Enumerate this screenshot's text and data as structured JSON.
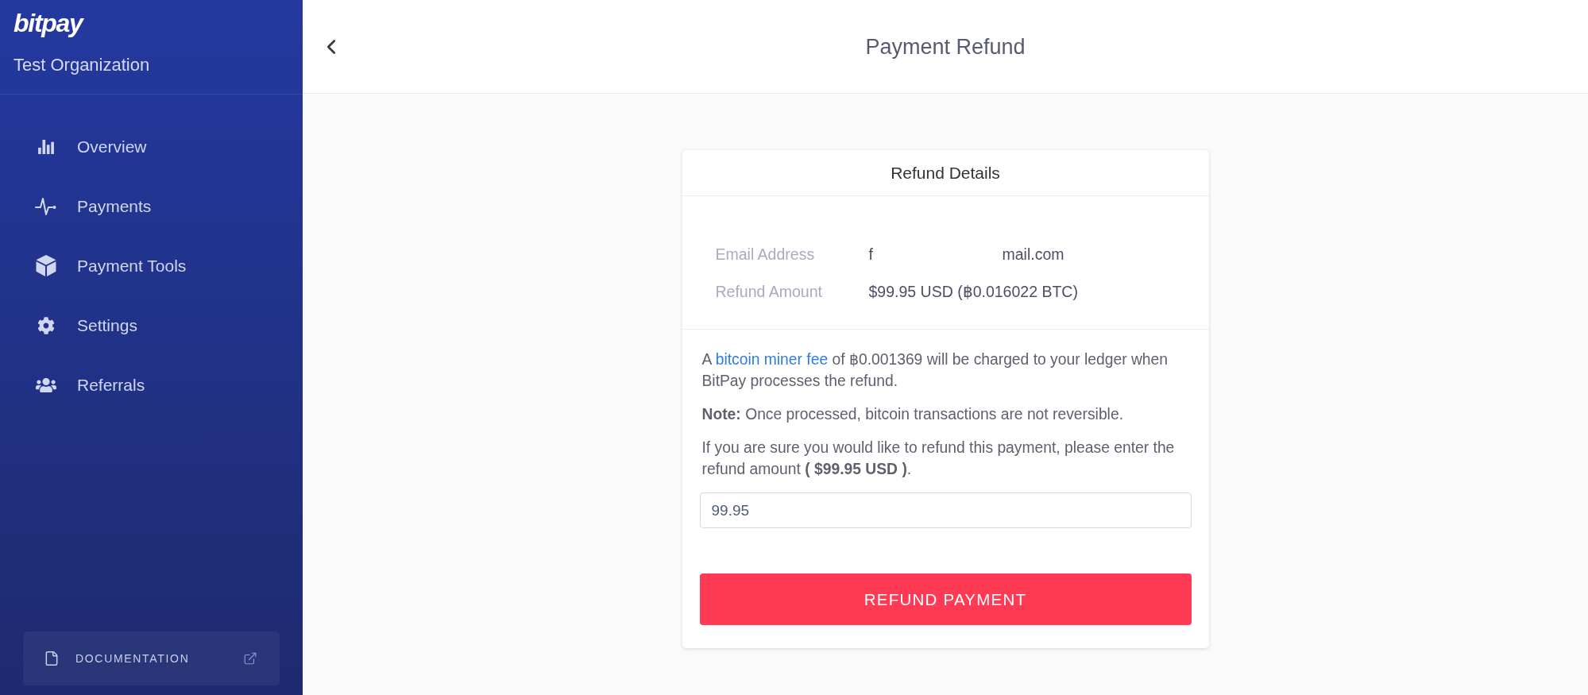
{
  "sidebar": {
    "logo": "bitpay",
    "organization": "Test Organization",
    "nav_items": [
      {
        "label": "Overview",
        "selected": false
      },
      {
        "label": "Payments",
        "selected": false
      },
      {
        "label": "Payment Tools",
        "selected": false
      },
      {
        "label": "Settings",
        "selected": false
      },
      {
        "label": "Referrals",
        "selected": false
      }
    ],
    "documentation_link": {
      "label": "DOCUMENTATION"
    }
  },
  "header": {
    "title": "Payment Refund"
  },
  "refund_card": {
    "title": "Refund Details",
    "details": [
      {
        "label": "Email Address",
        "values": [
          "f",
          "mail.com"
        ]
      },
      {
        "label": "Refund Amount",
        "values": [
          "$99.95 USD (฿0.016022 BTC)"
        ]
      }
    ],
    "fee_notice": {
      "before": "A",
      "link": "bitcoin miner fee",
      "after": "of ฿0.001369 will be charged to your ledger when BitPay processes the refund."
    },
    "note": "**Note:** Once processed, bitcoin transactions are not reversible.",
    "confirm_text": "If you are sure you would like to refund this payment, please enter the refund amount **( $99.95 USD )**.",
    "amount_field": {
      "value": "99.95"
    },
    "submit_button": "REFUND PAYMENT"
  }
}
